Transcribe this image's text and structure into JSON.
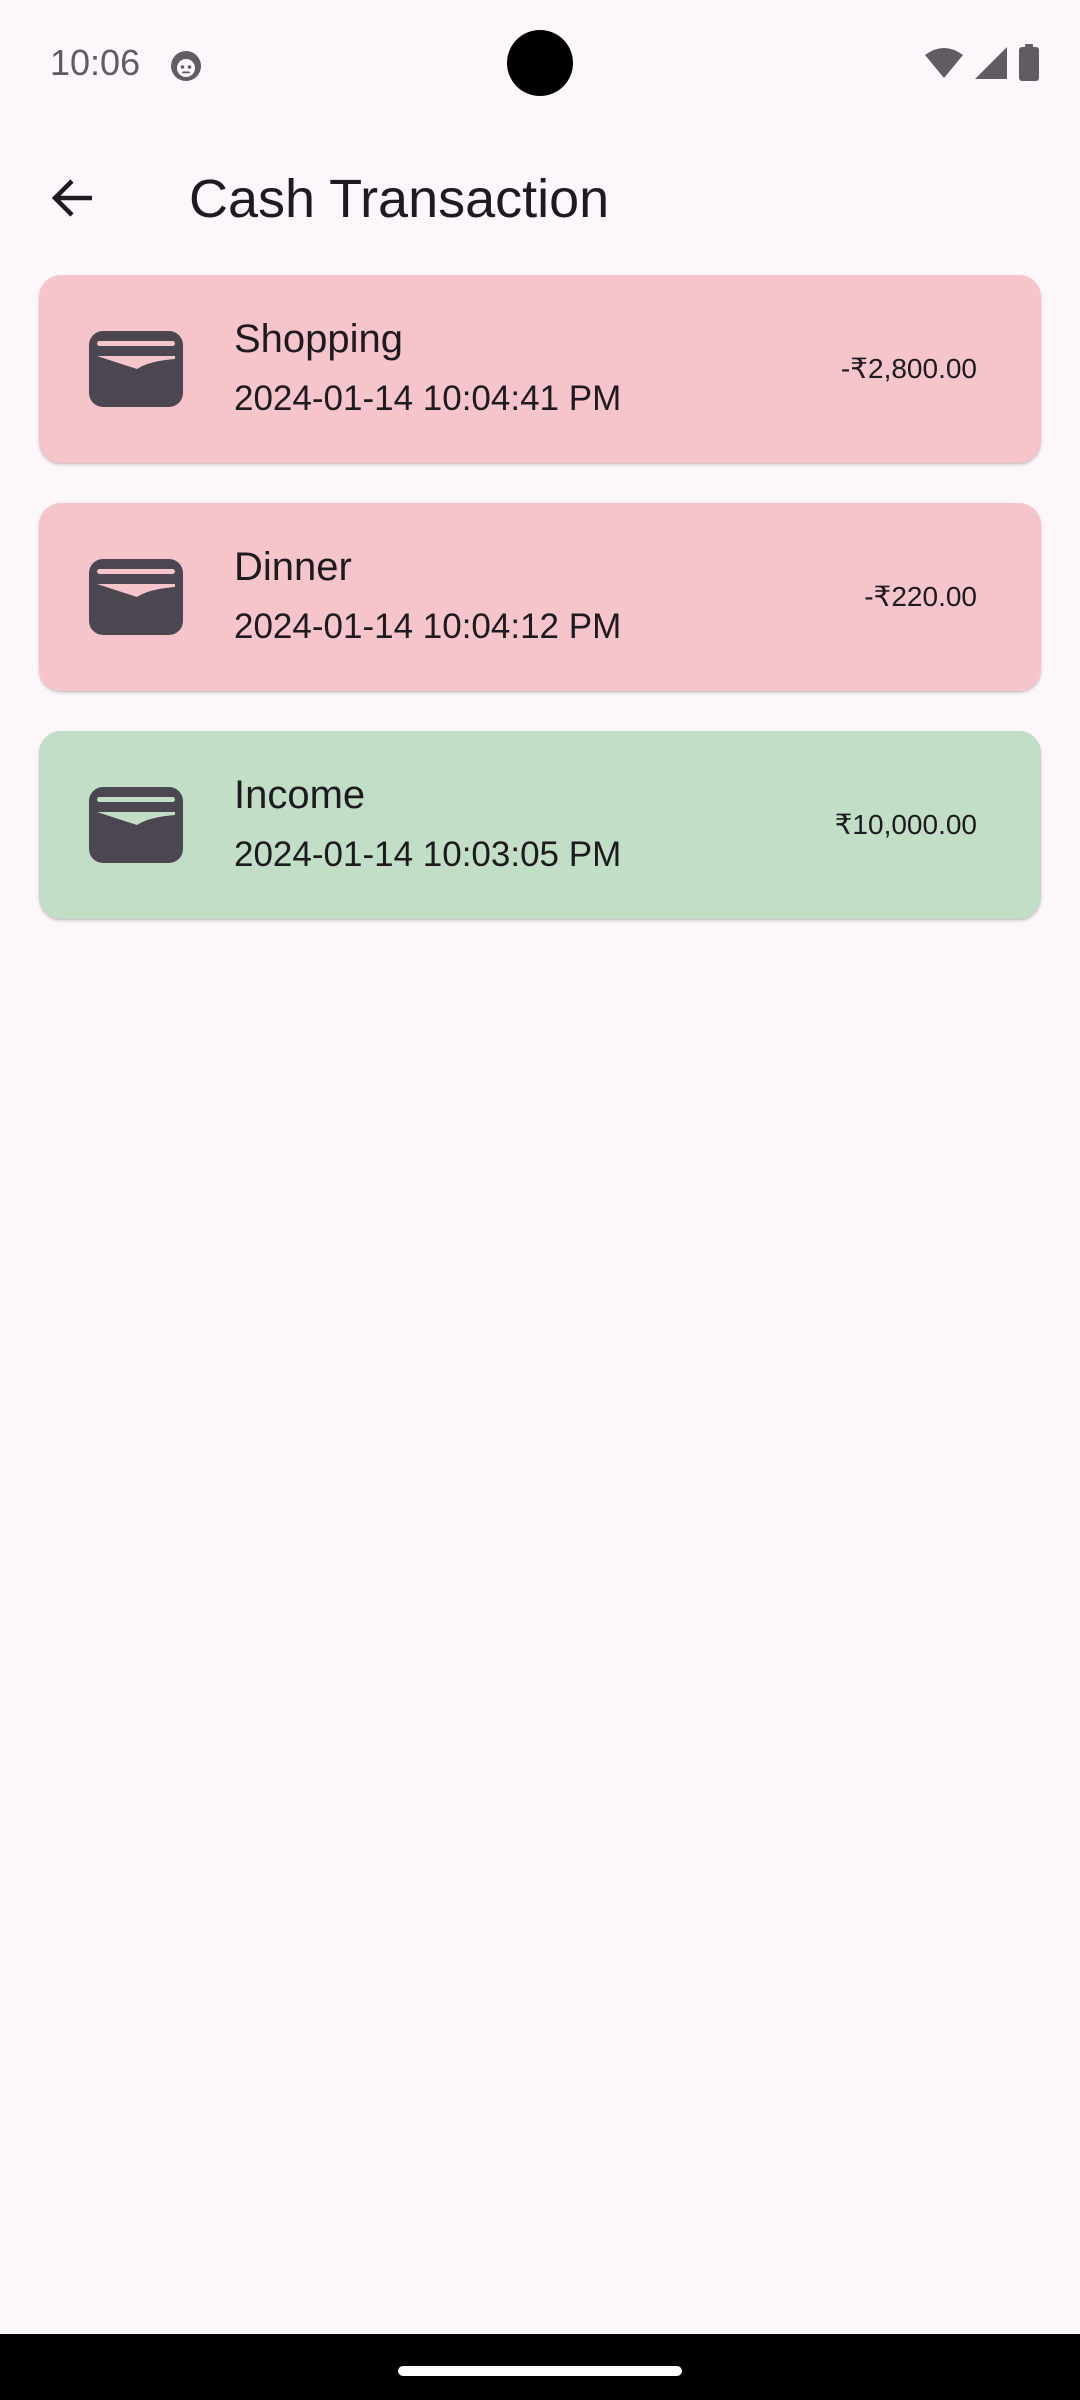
{
  "status_bar": {
    "time": "10:06",
    "app_icon": "notification-face-icon",
    "right_icons": [
      "wifi-icon",
      "cellular-signal-icon",
      "battery-icon"
    ]
  },
  "app_bar": {
    "back_icon": "arrow-back-icon",
    "title": "Cash Transaction"
  },
  "colors": {
    "expense_card": "#f6c5cc",
    "income_card": "#c2dec6",
    "icon_color": "#4c4650",
    "background": "#fdf7fb"
  },
  "transactions": [
    {
      "name": "Shopping",
      "datetime": "2024-01-14 10:04:41 PM",
      "amount": "-₹2,800.00",
      "type": "expense",
      "icon": "wallet-icon"
    },
    {
      "name": "Dinner",
      "datetime": "2024-01-14 10:04:12 PM",
      "amount": "-₹220.00",
      "type": "expense",
      "icon": "wallet-icon"
    },
    {
      "name": "Income",
      "datetime": "2024-01-14 10:03:05 PM",
      "amount": "₹10,000.00",
      "type": "income",
      "icon": "wallet-icon"
    }
  ]
}
